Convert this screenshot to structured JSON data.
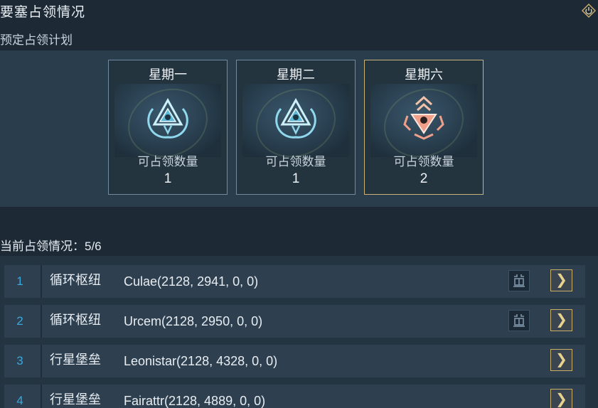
{
  "header": {
    "title": "要塞占领情况",
    "subtitle": "预定占领计划"
  },
  "plan": {
    "days": [
      {
        "day": "星期一",
        "capacity_label": "可占领数量",
        "capacity": "1",
        "emblem": "loop-hub-emblem"
      },
      {
        "day": "星期二",
        "capacity_label": "可占领数量",
        "capacity": "1",
        "emblem": "loop-hub-emblem"
      },
      {
        "day": "星期六",
        "capacity_label": "可占领数量",
        "capacity": "2",
        "emblem": "planet-fortress-emblem"
      }
    ]
  },
  "status": {
    "label": "当前占领情况：5/6"
  },
  "list": {
    "rows": [
      {
        "index": "1",
        "type": "循环枢纽",
        "name": "Culae(2128, 2941, 0, 0)",
        "has_ship_icon": true
      },
      {
        "index": "2",
        "type": "循环枢纽",
        "name": "Urcem(2128, 2950, 0, 0)",
        "has_ship_icon": true
      },
      {
        "index": "3",
        "type": "行星堡垒",
        "name": "Leonistar(2128, 4328, 0, 0)",
        "has_ship_icon": false
      },
      {
        "index": "4",
        "type": "行星堡垒",
        "name": "Fairattr(2128, 4889, 0, 0)",
        "has_ship_icon": false
      }
    ],
    "go_label": "❯"
  },
  "colors": {
    "accent_blue": "#3aa8de",
    "gold": "#c9b27a",
    "emblem_blue": "#8fd8ee",
    "emblem_orange": "#f0a08a"
  }
}
